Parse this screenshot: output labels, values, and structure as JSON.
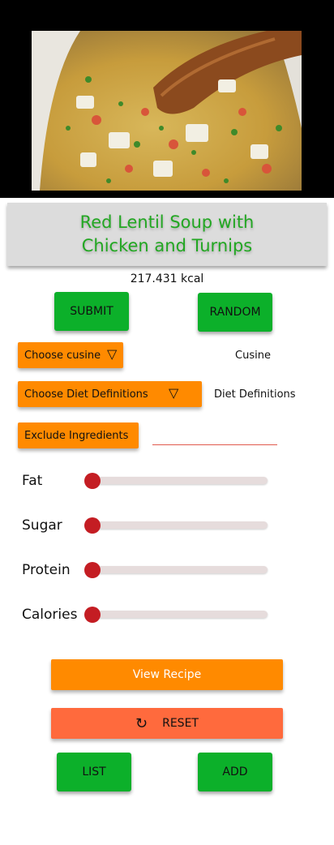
{
  "recipe": {
    "title": "Red Lentil Soup with Chicken and Turnips",
    "calories_text": "217.431 kcal"
  },
  "actions": {
    "submit_label": "SUBMIT",
    "random_label": "RANDOM"
  },
  "filters": {
    "cuisine_button": "Choose cusine",
    "cuisine_value": "Cusine",
    "diet_button": "Choose Diet Definitions",
    "diet_value": "Diet Definitions",
    "exclude_button": "Exclude Ingredients",
    "exclude_value": "",
    "caret_glyph": "▽"
  },
  "sliders": [
    {
      "label": "Fat",
      "value": 0
    },
    {
      "label": "Sugar",
      "value": 0
    },
    {
      "label": "Protein",
      "value": 0
    },
    {
      "label": "Calories",
      "value": 0
    }
  ],
  "bottom": {
    "view_recipe_label": "View Recipe",
    "reset_label": "RESET",
    "list_label": "LIST",
    "add_label": "ADD"
  },
  "icons": {
    "reset": "refresh-icon",
    "dropdown": "chevron-down-icon"
  },
  "colors": {
    "green": "#0cb02a",
    "title_green": "#22a722",
    "orange": "#ff8a00",
    "reset_red": "#ff6a3d",
    "slider_red": "#c41d23"
  }
}
